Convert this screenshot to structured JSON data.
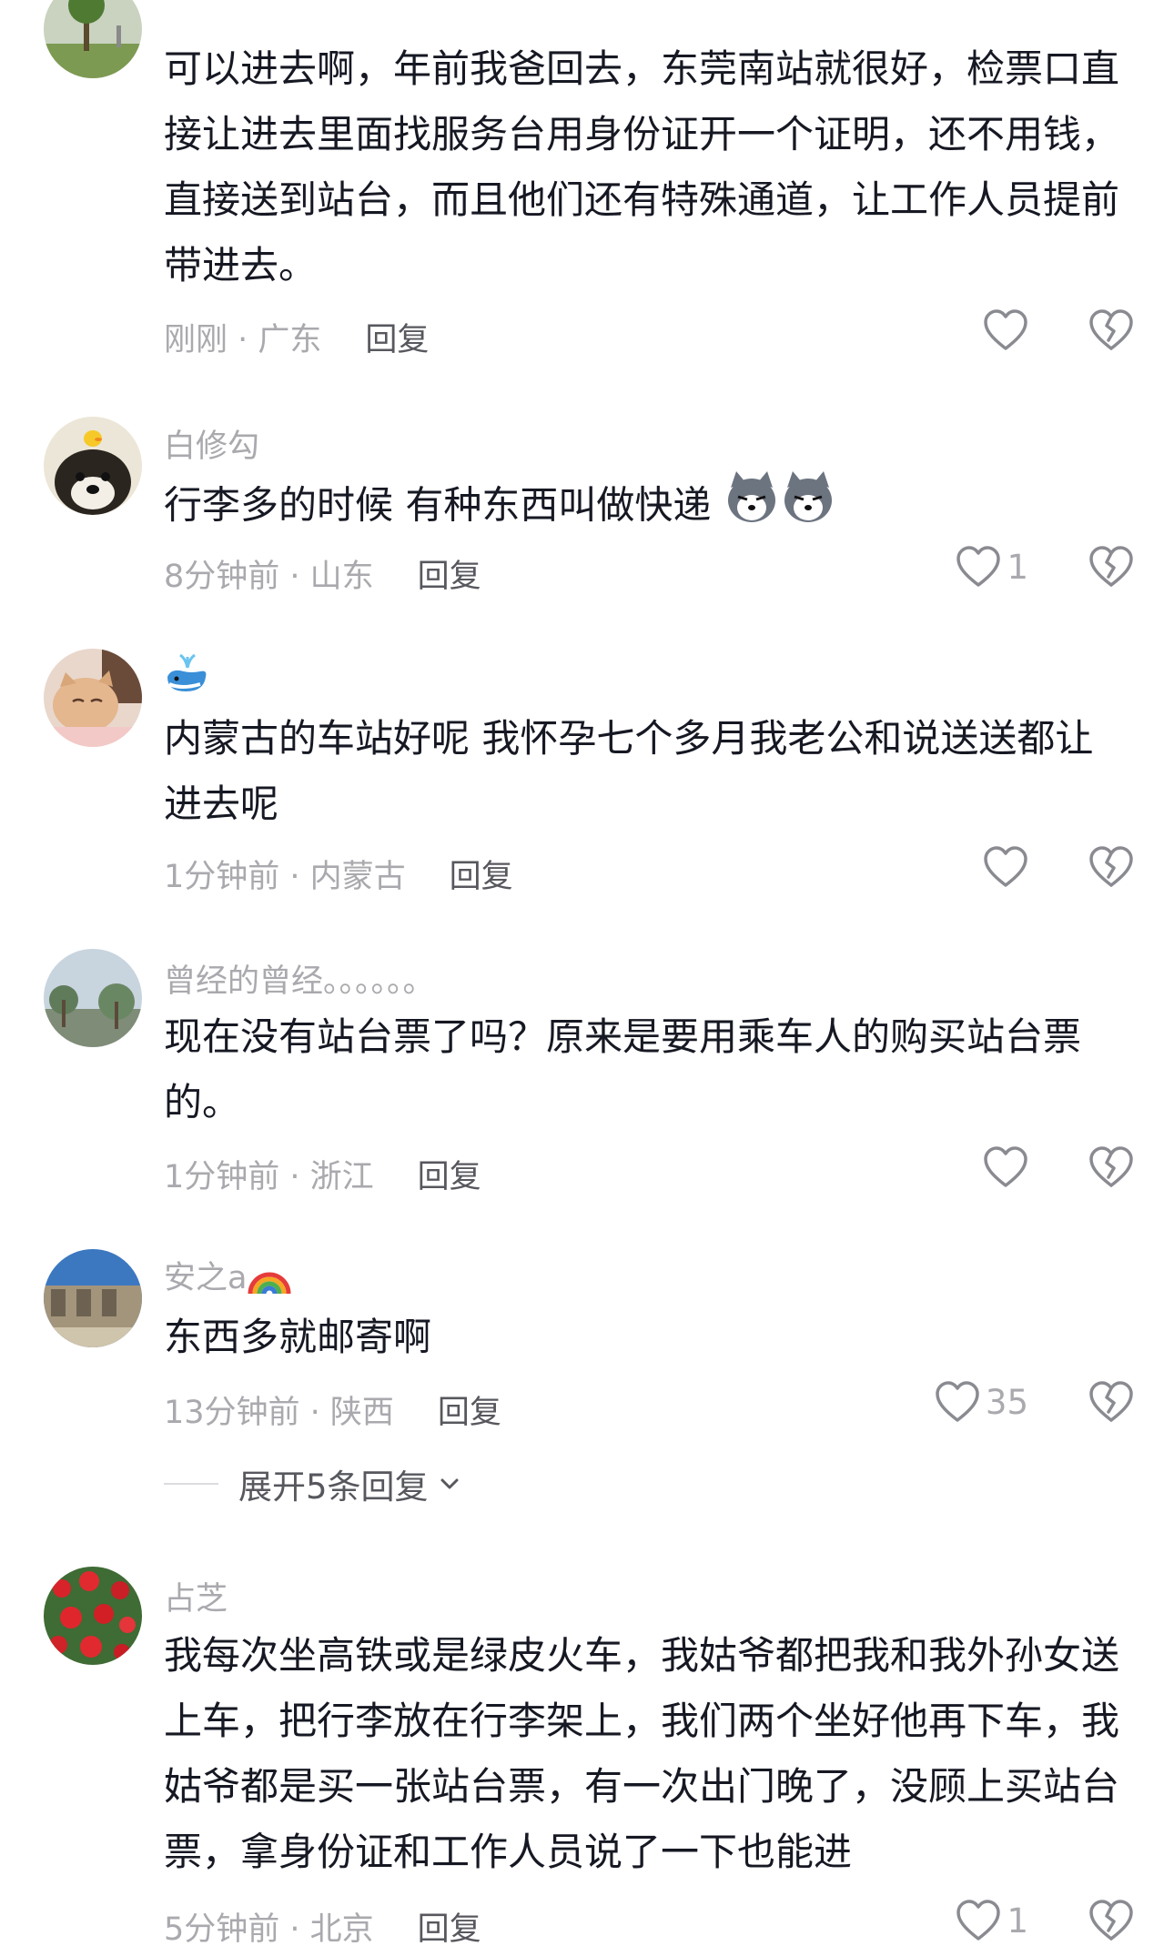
{
  "comments": [
    {
      "username": "",
      "text": "可以进去啊，年前我爸回去，东莞南站就很好，检票口直接让进去里面找服务台用身份证开一个证明，还不用钱，直接送到站台，而且他们还有特殊通道，让工作人员提前带进去。",
      "time_location": "刚刚 · 广东",
      "reply_label": "回复",
      "likes": ""
    },
    {
      "username": "白修勾",
      "text": "行李多的时候 有种东西叫做快递",
      "time_location": "8分钟前 · 山东",
      "reply_label": "回复",
      "likes": "1"
    },
    {
      "username": "",
      "text": "内蒙古的车站好呢 我怀孕七个多月我老公和说送送都让进去呢",
      "time_location": "1分钟前 · 内蒙古",
      "reply_label": "回复",
      "likes": ""
    },
    {
      "username": "曾经的曾经。。。。。。",
      "text": "现在没有站台票了吗？原来是要用乘车人的购买站台票的。",
      "time_location": "1分钟前 · 浙江",
      "reply_label": "回复",
      "likes": ""
    },
    {
      "username": "安之a",
      "text": "东西多就邮寄啊",
      "time_location": "13分钟前 · 陕西",
      "reply_label": "回复",
      "likes": "35",
      "expand_label": "展开5条回复"
    },
    {
      "username": "占芝",
      "text": "我每次坐高铁或是绿皮火车，我姑爷都把我和我外孙女送上车，把行李放在行李架上，我们两个坐好他再下车，我姑爷都是买一张站台票，有一次出门晚了，没顾上买站台票，拿身份证和工作人员说了一下也能进",
      "time_location": "5分钟前 · 北京",
      "reply_label": "回复",
      "likes": "1"
    }
  ],
  "icons": {
    "like": "heart-outline-icon",
    "dislike": "broken-heart-icon",
    "expand": "chevron-down-icon"
  }
}
